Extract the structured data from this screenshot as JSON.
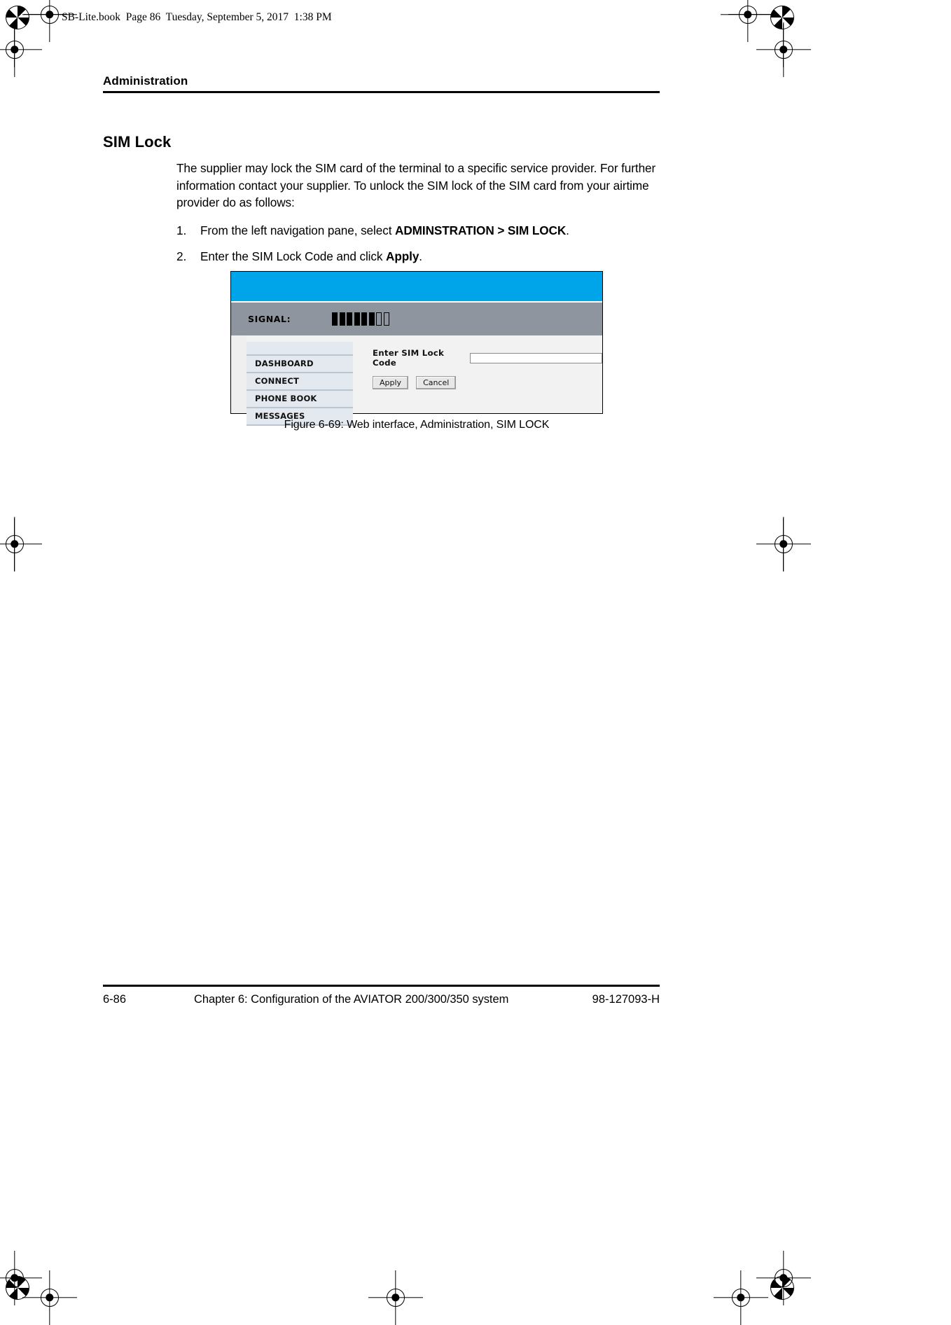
{
  "slug": "SB-Lite.book  Page 86  Tuesday, September 5, 2017  1:38 PM",
  "running_head": "Administration",
  "section": {
    "heading": "SIM Lock",
    "paragraph": "The supplier may lock the SIM card of the terminal to a specific service provider. For further information contact your supplier. To unlock the SIM lock of the SIM card from your airtime provider do as follows:",
    "steps": [
      {
        "number": "1.",
        "text_before": "From the left navigation pane, select ",
        "bold": "ADMINSTRATION > SIM LOCK",
        "text_after": "."
      },
      {
        "number": "2.",
        "text_before": "Enter the SIM Lock Code and click ",
        "bold": "Apply",
        "text_after": "."
      }
    ]
  },
  "figure": {
    "caption": "Figure 6-69: Web interface, Administration, SIM LOCK",
    "banner_color": "#00a4e8",
    "signal_bar_color": "#8e959e",
    "signal": {
      "label": "SIGNAL:",
      "filled_bars": 6,
      "empty_bars": 2
    },
    "nav_items": [
      {
        "label": "DASHBOARD"
      },
      {
        "label": "CONNECT"
      },
      {
        "label": "PHONE BOOK"
      },
      {
        "label": "MESSAGES"
      }
    ],
    "form": {
      "label": "Enter SIM Lock Code",
      "input_value": "",
      "input_placeholder": "",
      "apply_label": "Apply",
      "cancel_label": "Cancel"
    }
  },
  "footer": {
    "page_number": "6-86",
    "chapter": "Chapter 6:  Configuration of the AVIATOR 200/300/350 system",
    "doc_number": "98-127093-H"
  }
}
